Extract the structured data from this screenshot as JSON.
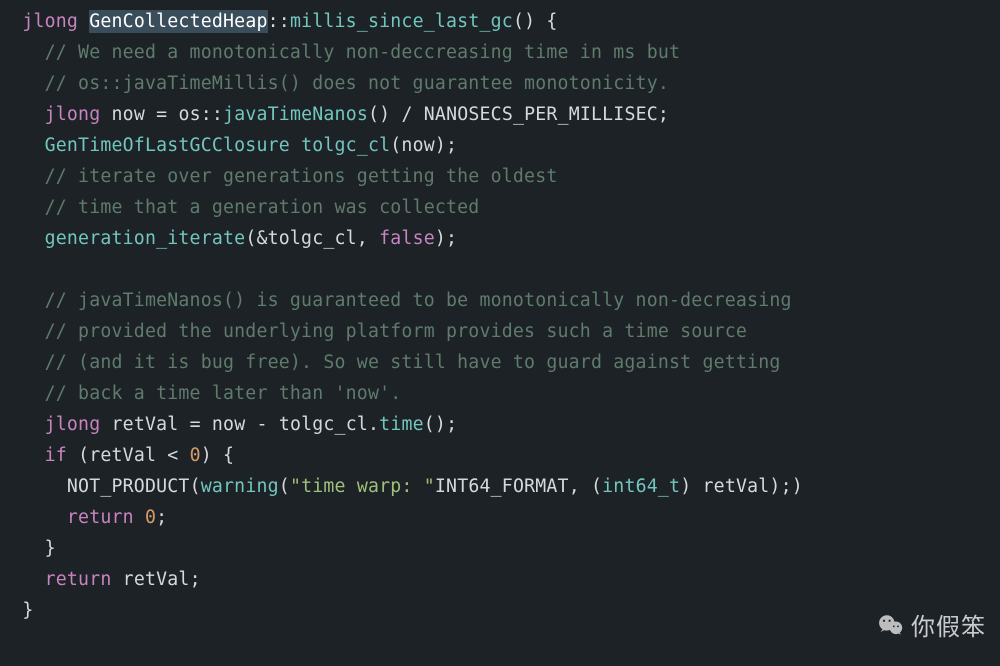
{
  "code": {
    "l1": {
      "kw": "jlong",
      "cls": "GenCollectedHeap",
      "op": "::",
      "fn": "millis_since_last_gc",
      "p": "() {"
    },
    "l2": "// We need a monotonically non-deccreasing time in ms but",
    "l3": "// os::javaTimeMillis() does not guarantee monotonicity.",
    "l4": {
      "kw": "jlong",
      "id": "now",
      "eq": "=",
      "ns": "os",
      "op": "::",
      "fn": "javaTimeNanos",
      "p": "() / ",
      "c": "NANOSECS_PER_MILLISEC",
      "sc": ";"
    },
    "l5": {
      "t": "GenTimeOfLastGCClosure",
      "fn": "tolgc_cl",
      "p": "(now);"
    },
    "l6": "// iterate over generations getting the oldest",
    "l7": "// time that a generation was collected",
    "l8": {
      "fn": "generation_iterate",
      "p1": "(&tolgc_cl, ",
      "kw": "false",
      "p2": ");"
    },
    "l10": "// javaTimeNanos() is guaranteed to be monotonically non-decreasing",
    "l11": "// provided the underlying platform provides such a time source",
    "l12": "// (and it is bug free). So we still have to guard against getting",
    "l13": "// back a time later than 'now'.",
    "l14": {
      "kw": "jlong",
      "id": "retVal",
      "eq": "=",
      "a": "now",
      "op": "-",
      "b": "tolgc_cl.",
      "fn": "time",
      "p": "();"
    },
    "l15": {
      "kw": "if",
      "p1": "(retVal ",
      "op": "<",
      "p2": " ",
      "num": "0",
      "p3": ") {"
    },
    "l16": {
      "m": "NOT_PRODUCT",
      "p1": "(",
      "fn": "warning",
      "p2": "(",
      "s": "\"time warp: \"",
      "c": "INT64_FORMAT",
      "p3": ", (",
      "t": "int64_t",
      "p4": ") retVal);)"
    },
    "l17": {
      "kw": "return",
      "num": "0",
      "sc": ";"
    },
    "l18": "}",
    "l19": {
      "kw": "return",
      "id": "retVal",
      "sc": ";"
    },
    "l20": "}"
  },
  "watermark": {
    "text": "你假笨",
    "icon": "wechat-icon"
  },
  "colors": {
    "background": "#1d2227",
    "selection": "#3a4d5a",
    "comment": "#5f7b6b",
    "keyword": "#c884c0",
    "type": "#72c6be",
    "string": "#a0bf7c",
    "number": "#d49a66",
    "default": "#d6d9dc"
  }
}
